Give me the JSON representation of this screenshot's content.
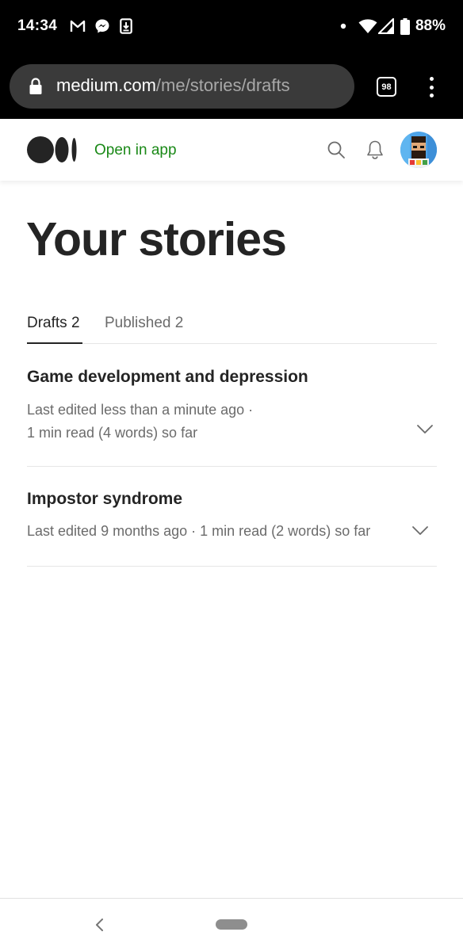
{
  "status_bar": {
    "time": "14:34",
    "battery": "88%",
    "notification_icons": [
      "gmail-icon",
      "messenger-icon",
      "download-icon"
    ],
    "system_icons": [
      "dot-icon",
      "wifi-icon",
      "signal-icon",
      "battery-icon"
    ]
  },
  "browser": {
    "url_domain": "medium.com",
    "url_path": "/me/stories/drafts",
    "tab_count": "98"
  },
  "header": {
    "open_in_app": "Open in app",
    "accent_color": "#1a8917"
  },
  "page": {
    "title": "Your stories"
  },
  "tabs": [
    {
      "label": "Drafts 2",
      "active": true
    },
    {
      "label": "Published 2",
      "active": false
    }
  ],
  "stories": [
    {
      "title": "Game development and depression",
      "meta_line1": "Last edited less than a minute ago ·",
      "meta_line2": "1 min read (4 words) so far"
    },
    {
      "title": "Impostor syndrome",
      "meta_line1": "Last edited 9 months ago · 1 min read (2 words) so far"
    }
  ]
}
